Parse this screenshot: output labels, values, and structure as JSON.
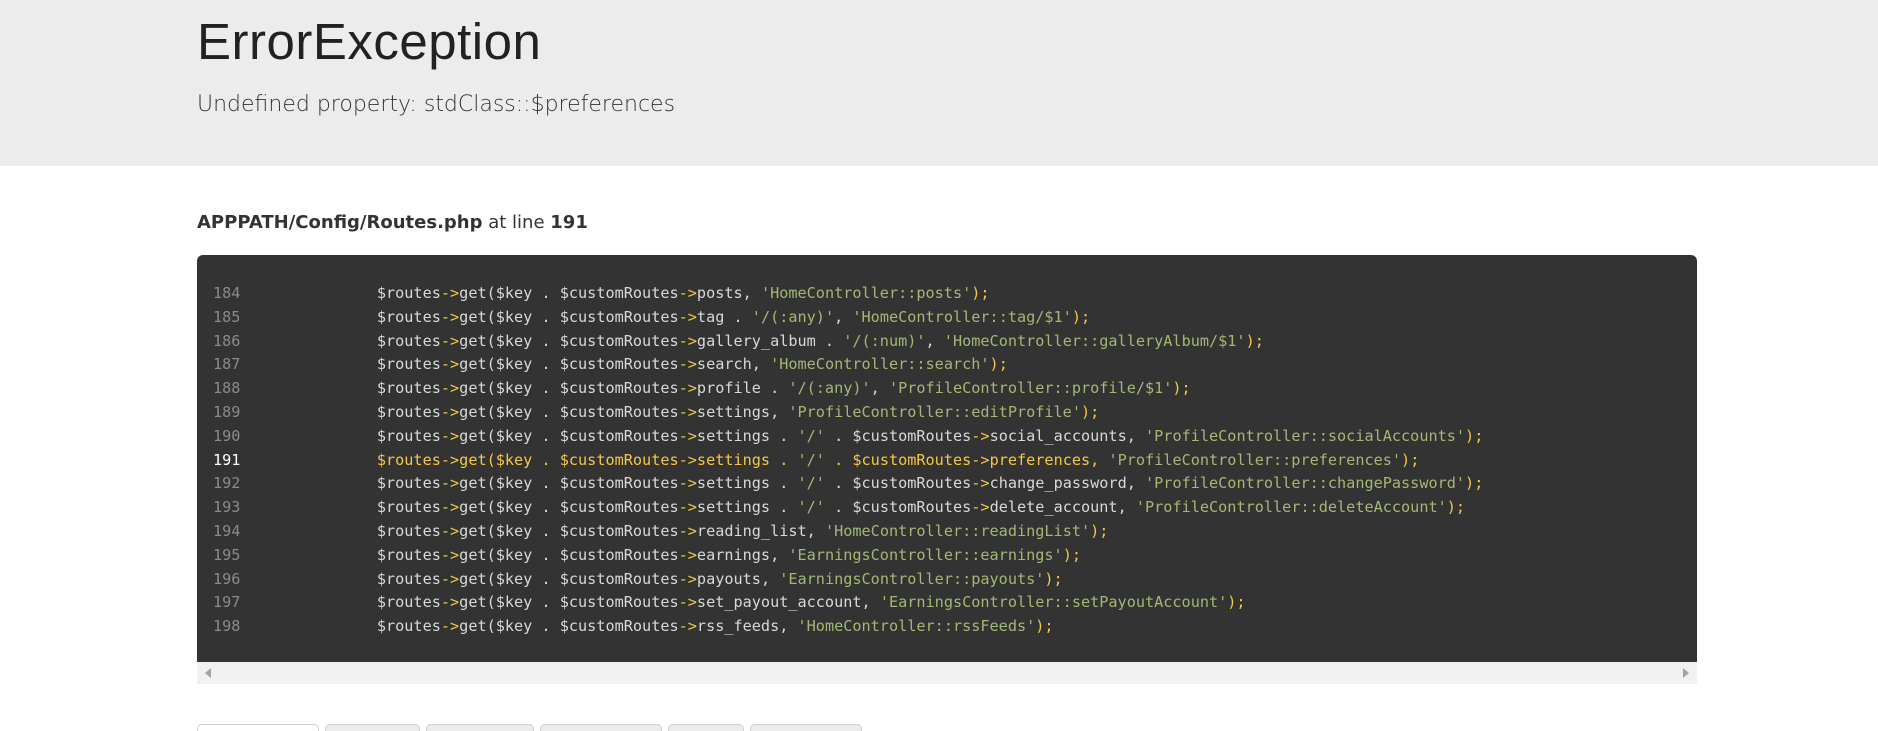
{
  "error": {
    "title": "ErrorException",
    "message": "Undefined property: stdClass::$preferences"
  },
  "source": {
    "file": "APPPATH/Config/Routes.php",
    "at_text": "at line",
    "line": "191"
  },
  "highlight_line": 191,
  "code_lines": [
    {
      "num": "184",
      "prop": "posts",
      "tail": ", ",
      "str": "'HomeController::posts'"
    },
    {
      "num": "185",
      "prop": "tag . ",
      "tail": "",
      "str": "'/(:any)'",
      "str2": "'HomeController::tag/$1'"
    },
    {
      "num": "186",
      "prop": "gallery_album . ",
      "tail": "",
      "str": "'/(:num)'",
      "str2": "'HomeController::galleryAlbum/$1'"
    },
    {
      "num": "187",
      "prop": "search",
      "tail": ", ",
      "str": "'HomeController::search'"
    },
    {
      "num": "188",
      "prop": "profile . ",
      "tail": "",
      "str": "'/(:any)'",
      "str2": "'ProfileController::profile/$1'"
    },
    {
      "num": "189",
      "prop": "settings",
      "tail": ", ",
      "str": "'ProfileController::editProfile'"
    },
    {
      "num": "190",
      "prop": "settings . ",
      "seg": "social_accounts",
      "str": "'ProfileController::socialAccounts'"
    },
    {
      "num": "191",
      "prop": "settings . ",
      "seg": "preferences",
      "str": "'ProfileController::preferences'"
    },
    {
      "num": "192",
      "prop": "settings . ",
      "seg": "change_password",
      "str": "'ProfileController::changePassword'"
    },
    {
      "num": "193",
      "prop": "settings . ",
      "seg": "delete_account",
      "str": "'ProfileController::deleteAccount'"
    },
    {
      "num": "194",
      "prop": "reading_list",
      "tail": ", ",
      "str": "'HomeController::readingList'"
    },
    {
      "num": "195",
      "prop": "earnings",
      "tail": ", ",
      "str": "'EarningsController::earnings'"
    },
    {
      "num": "196",
      "prop": "payouts",
      "tail": ", ",
      "str": "'EarningsController::payouts'"
    },
    {
      "num": "197",
      "prop": "set_payout_account",
      "tail": ", ",
      "str": "'EarningsController::setPayoutAccount'"
    },
    {
      "num": "198",
      "prop": "rss_feeds",
      "tail": ", ",
      "str": "'HomeController::rssFeeds'"
    }
  ],
  "tabs": [
    "",
    "",
    "",
    "",
    "",
    ""
  ],
  "colors": {
    "header_bg": "#ececec",
    "code_bg": "#333333",
    "operator": "#f5c646",
    "string": "#a3b872",
    "line_number": "#8a8a8a"
  }
}
